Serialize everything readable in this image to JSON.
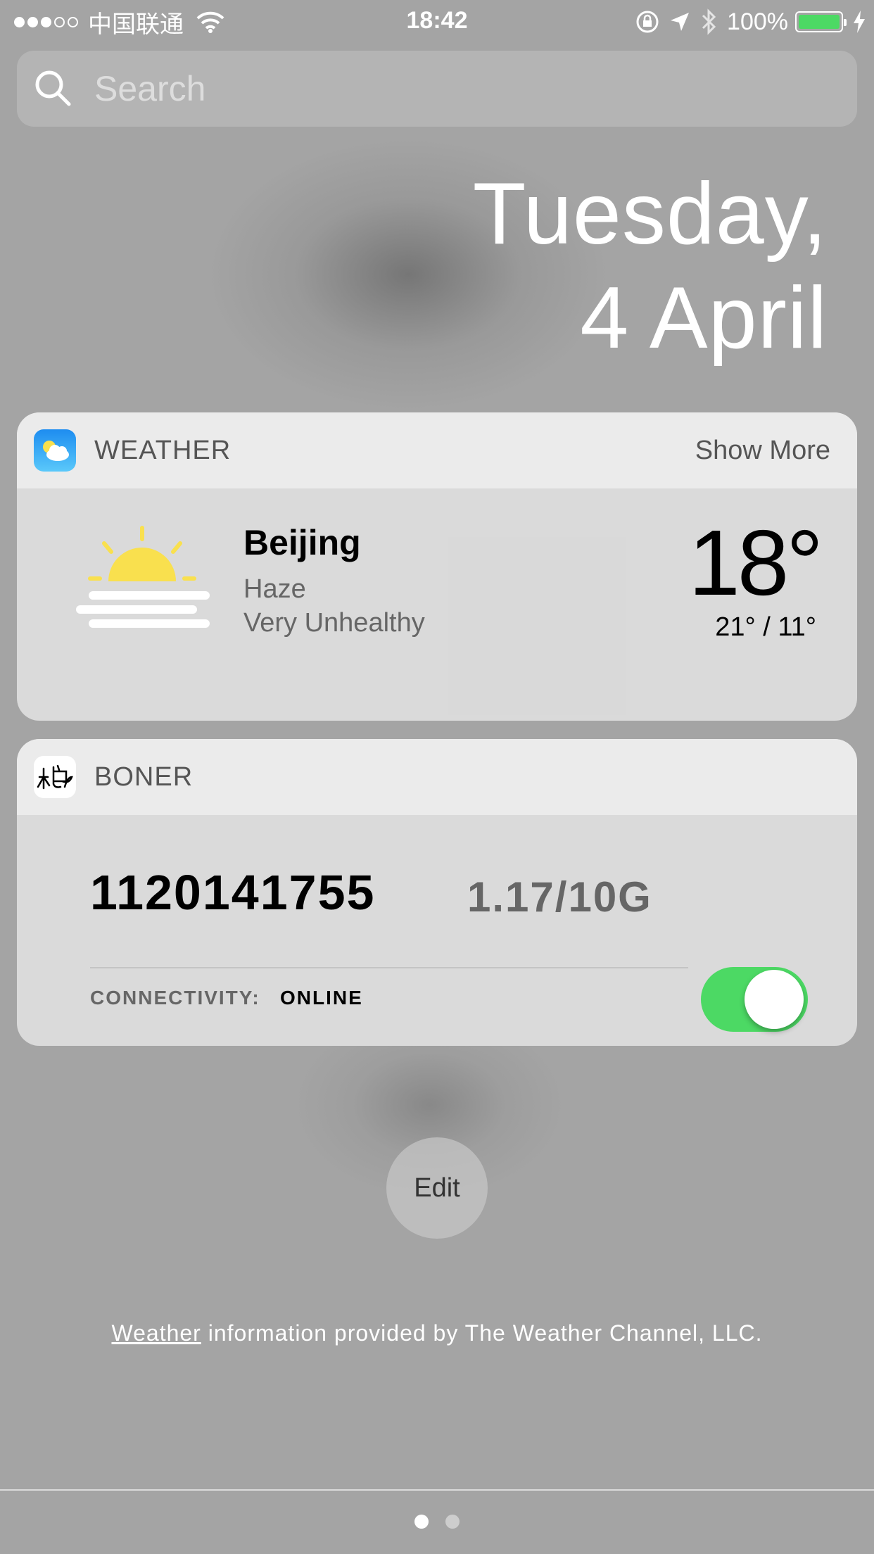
{
  "status_bar": {
    "carrier": "中国联通",
    "time": "18:42",
    "battery_percent": "100%",
    "battery_level": 1.0,
    "signal_bars_filled": 3,
    "signal_bars_total": 5
  },
  "search": {
    "placeholder": "Search"
  },
  "date": {
    "line1": "Tuesday,",
    "line2": "4 April"
  },
  "weather_widget": {
    "title": "WEATHER",
    "show_more": "Show More",
    "city": "Beijing",
    "condition": "Haze",
    "air_quality": "Very Unhealthy",
    "temperature": "18°",
    "hi_lo": "21° / 11°",
    "icon": "haze-sun-icon"
  },
  "boner_widget": {
    "title": "BONER",
    "account": "1120141755",
    "usage": "1.17/10G",
    "connectivity_label": "CONNECTIVITY:",
    "connectivity_value": "ONLINE",
    "toggle_on": true
  },
  "edit_button": {
    "label": "Edit"
  },
  "attribution": {
    "link": "Weather",
    "text": " information provided by The Weather Channel, LLC."
  },
  "pagination": {
    "current": 1,
    "total": 2
  },
  "colors": {
    "accent_green": "#4cd964",
    "sun_yellow": "#f9e04e",
    "background": "#a4a4a4"
  }
}
